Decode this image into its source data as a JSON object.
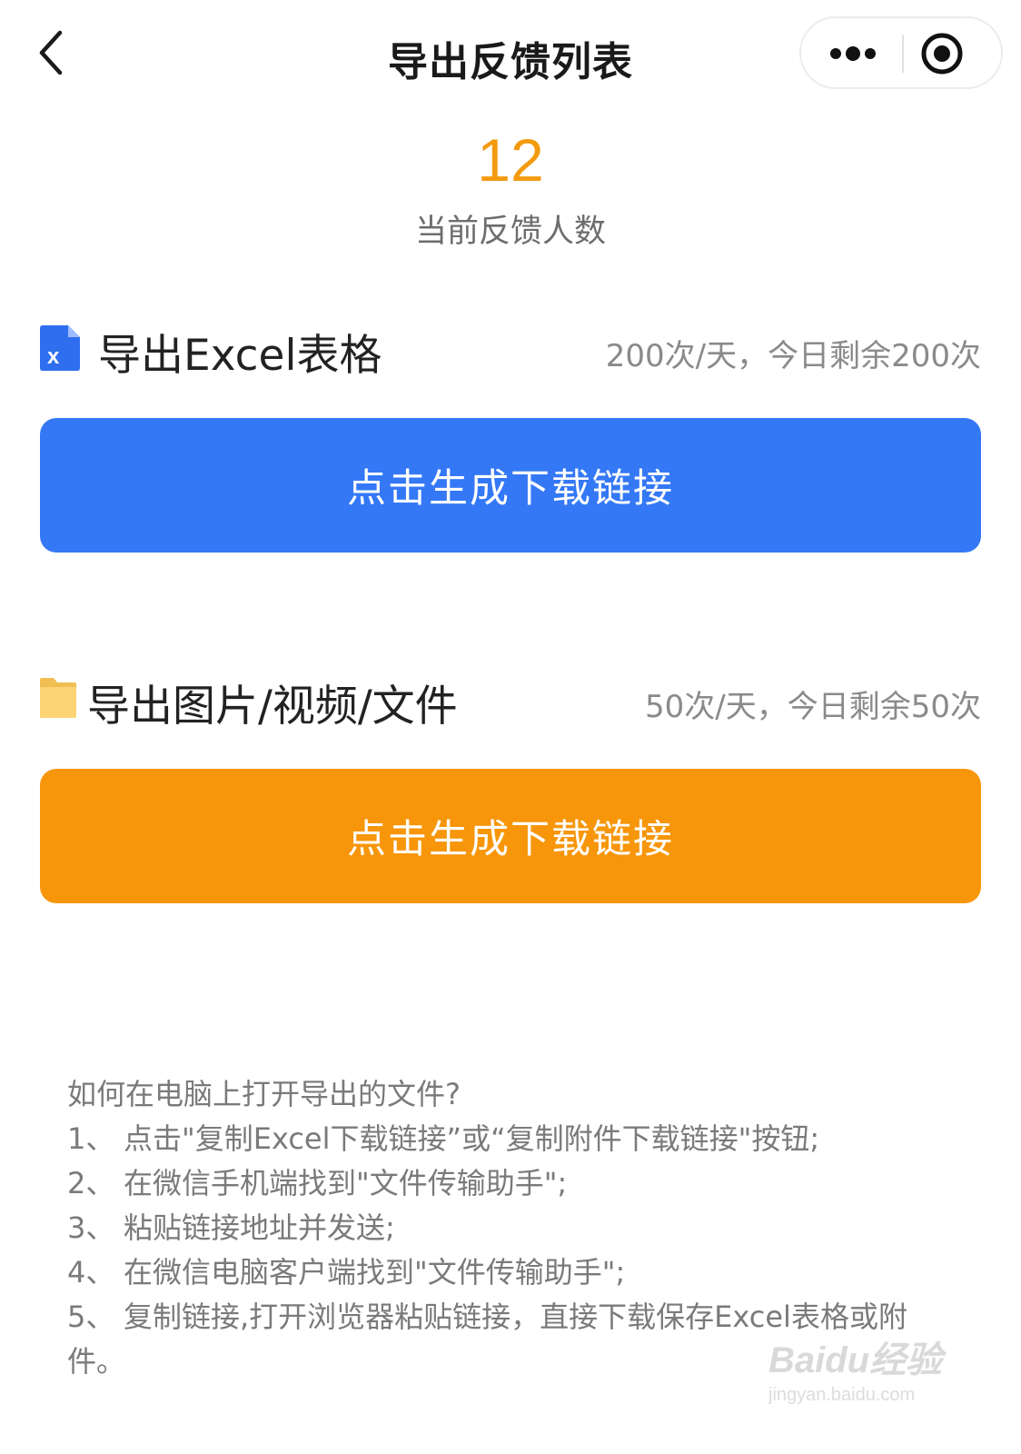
{
  "nav": {
    "title": "导出反馈列表",
    "back_icon": "chevron-left-icon",
    "more_icon": "more-dots-icon",
    "close_icon": "target-close-icon"
  },
  "summary": {
    "count": "12",
    "label": "当前反馈人数"
  },
  "excel_section": {
    "icon": "excel-file-icon",
    "title": "导出Excel表格",
    "quota": "200次/天，今日剩余200次",
    "button_label": "点击生成下载链接",
    "button_color": "#3478f6"
  },
  "media_section": {
    "icon": "folder-icon",
    "title": "导出图片/视频/文件",
    "quota": "50次/天，今日剩余50次",
    "button_label": "点击生成下载链接",
    "button_color": "#f7960a"
  },
  "help": {
    "heading": "如何在电脑上打开导出的文件?",
    "steps": [
      {
        "num": "1、",
        "text": "点击\"复制Excel下载链接”或“复制附件下载链接\"按钮;"
      },
      {
        "num": "2、",
        "text": "在微信手机端找到\"文件传输助手\";"
      },
      {
        "num": "3、",
        "text": "粘贴链接地址并发送;"
      },
      {
        "num": "4、",
        "text": "在微信电脑客户端找到\"文件传输助手\";"
      },
      {
        "num": "5、",
        "text": "复制链接,打开浏览器粘贴链接，直接下载保存Excel表格或附件。"
      }
    ]
  },
  "watermark": {
    "logo": "Baidu经验",
    "url": "jingyan.baidu.com"
  }
}
